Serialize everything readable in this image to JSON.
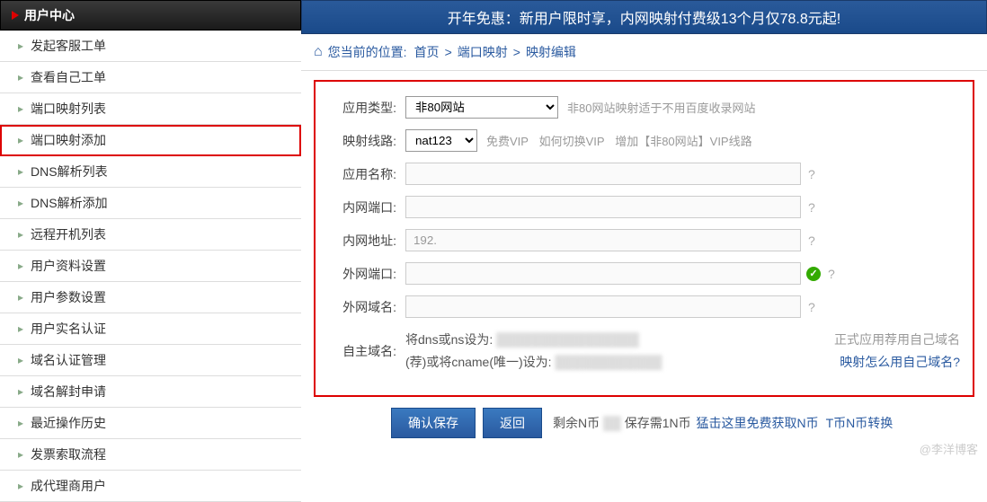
{
  "sidebar": {
    "header": "用户中心",
    "items": [
      {
        "label": "发起客服工单",
        "hl": false
      },
      {
        "label": "查看自己工单",
        "hl": false
      },
      {
        "label": "端口映射列表",
        "hl": false
      },
      {
        "label": "端口映射添加",
        "hl": true
      },
      {
        "label": "DNS解析列表",
        "hl": false
      },
      {
        "label": "DNS解析添加",
        "hl": false
      },
      {
        "label": "远程开机列表",
        "hl": false
      },
      {
        "label": "用户资料设置",
        "hl": false
      },
      {
        "label": "用户参数设置",
        "hl": false
      },
      {
        "label": "用户实名认证",
        "hl": false
      },
      {
        "label": "域名认证管理",
        "hl": false
      },
      {
        "label": "域名解封申请",
        "hl": false
      },
      {
        "label": "最近操作历史",
        "hl": false
      },
      {
        "label": "发票索取流程",
        "hl": false
      },
      {
        "label": "成代理商用户",
        "hl": false
      }
    ]
  },
  "banner": "开年免惠：新用户限时享，内网映射付费级13个月仅78.8元起!",
  "breadcrumb": {
    "label": "您当前的位置:",
    "home": "首页",
    "section": "端口映射",
    "current": "映射编辑"
  },
  "form": {
    "appType": {
      "label": "应用类型:",
      "value": "非80网站",
      "hint": "非80网站映射适于不用百度收录网站"
    },
    "line": {
      "label": "映射线路:",
      "value": "nat123",
      "links": {
        "freeVip": "免费VIP",
        "howSwitch": "如何切换VIP",
        "addLine": "增加【非80网站】VIP线路"
      }
    },
    "appName": {
      "label": "应用名称:",
      "value": ""
    },
    "innerPort": {
      "label": "内网端口:",
      "value": ""
    },
    "innerAddr": {
      "label": "内网地址:",
      "value": "192."
    },
    "outerPort": {
      "label": "外网端口:",
      "value": ""
    },
    "outerDomain": {
      "label": "外网域名:",
      "value": ""
    },
    "ownDomain": {
      "label": "自主域名:",
      "l1a": "将dns或ns设为:",
      "l1b": "正式应用荐用自己域名",
      "l2a": "(荐)或将cname(唯一)设为:",
      "l2q": "映射怎么用自己域名?"
    }
  },
  "buttons": {
    "save": "确认保存",
    "back": "返回"
  },
  "remain": {
    "prefix": "剩余N币",
    "need": "保存需1N币",
    "getFree": "猛击这里免费获取N币",
    "exchange": "T币N币转换"
  },
  "q": "?",
  "watermark": "@李洋博客"
}
